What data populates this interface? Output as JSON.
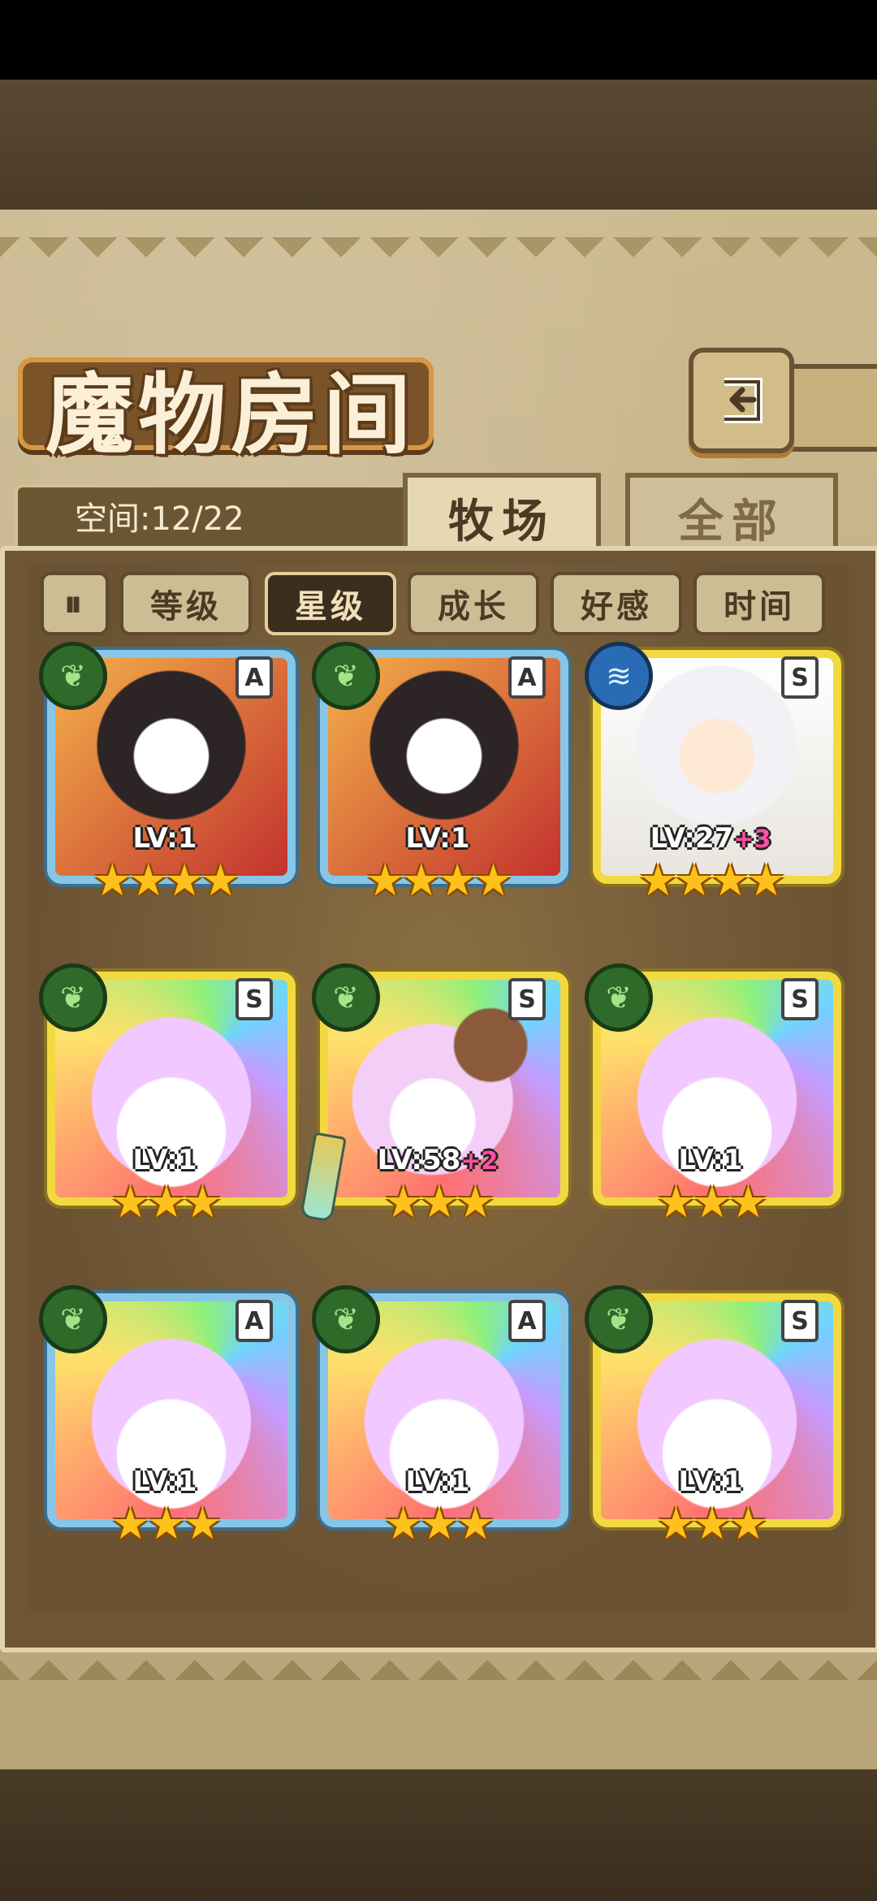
{
  "title": "魔物房间",
  "space": {
    "text": "空间:12/22"
  },
  "tabs": [
    {
      "label": "牧场",
      "active": true
    },
    {
      "label": "全部",
      "active": false
    }
  ],
  "sort_buttons": [
    {
      "label": "等级",
      "active": false
    },
    {
      "label": "星级",
      "active": true
    },
    {
      "label": "成长",
      "active": false
    },
    {
      "label": "好感",
      "active": false
    },
    {
      "label": "时间",
      "active": false
    }
  ],
  "icons": {
    "back": "back-arrow-icon",
    "toggle": "pause-toggle-icon",
    "element_grass": "leaf-icon",
    "element_water": "water-waves-icon"
  },
  "monsters": [
    {
      "rank": "A",
      "level": "LV:1",
      "plus": "",
      "stars": 4,
      "element": "grass",
      "frame": "blue"
    },
    {
      "rank": "A",
      "level": "LV:1",
      "plus": "",
      "stars": 4,
      "element": "grass",
      "frame": "blue"
    },
    {
      "rank": "S",
      "level": "LV:27",
      "plus": "+3",
      "stars": 4,
      "element": "water",
      "frame": "gold"
    },
    {
      "rank": "S",
      "level": "LV:1",
      "plus": "",
      "stars": 3,
      "element": "grass",
      "frame": "gold"
    },
    {
      "rank": "S",
      "level": "LV:58",
      "plus": "+2",
      "stars": 3,
      "element": "grass",
      "frame": "gold"
    },
    {
      "rank": "S",
      "level": "LV:1",
      "plus": "",
      "stars": 3,
      "element": "grass",
      "frame": "gold"
    },
    {
      "rank": "A",
      "level": "LV:1",
      "plus": "",
      "stars": 3,
      "element": "grass",
      "frame": "blue"
    },
    {
      "rank": "A",
      "level": "LV:1",
      "plus": "",
      "stars": 3,
      "element": "grass",
      "frame": "blue"
    },
    {
      "rank": "S",
      "level": "LV:1",
      "plus": "",
      "stars": 3,
      "element": "grass",
      "frame": "gold"
    }
  ],
  "colors": {
    "blue_frame": "#87c6e7",
    "gold_frame": "#f2d940",
    "star": "#ffc21c",
    "plus_level": "#ff4fa1"
  }
}
